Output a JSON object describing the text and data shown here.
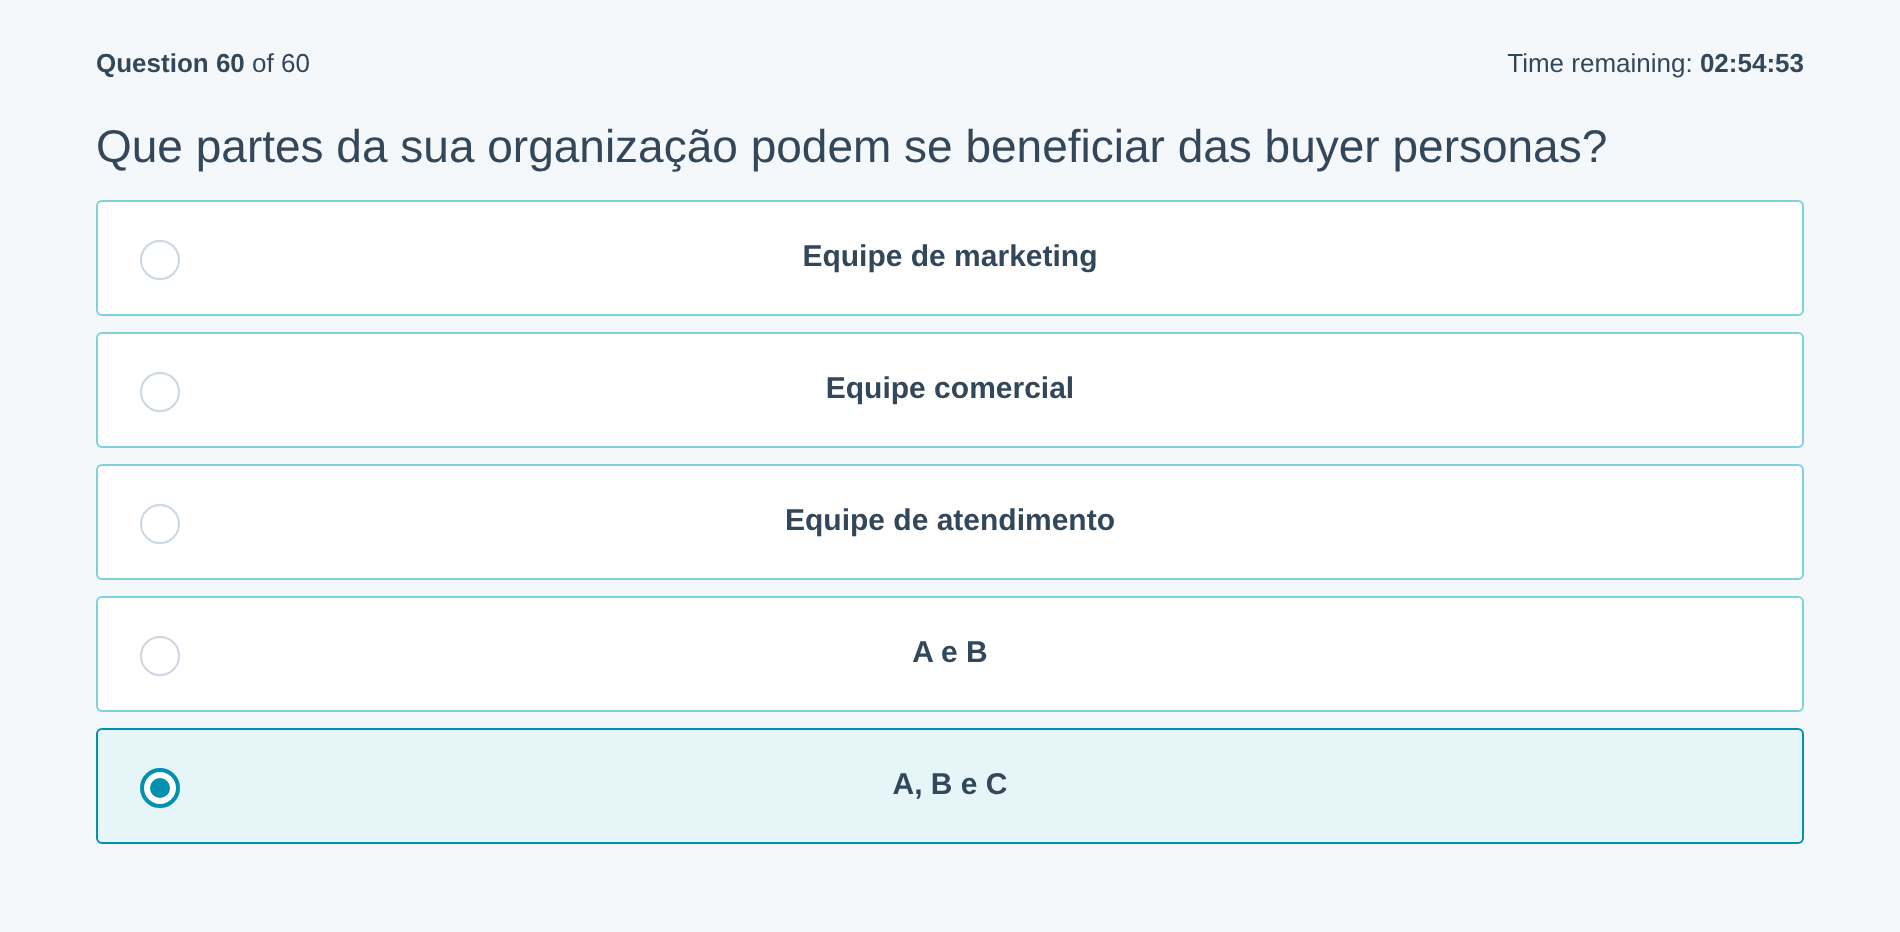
{
  "header": {
    "question_label": "Question",
    "question_number": "60",
    "of_text": "of 60",
    "time_label": "Time remaining:",
    "time_value": "02:54:53"
  },
  "question": "Que partes da sua organização podem se beneficiar das buyer personas?",
  "options": [
    {
      "label": "Equipe de marketing",
      "selected": false
    },
    {
      "label": "Equipe comercial",
      "selected": false
    },
    {
      "label": "Equipe de atendimento",
      "selected": false
    },
    {
      "label": "A e B",
      "selected": false
    },
    {
      "label": "A, B e C",
      "selected": true
    }
  ]
}
